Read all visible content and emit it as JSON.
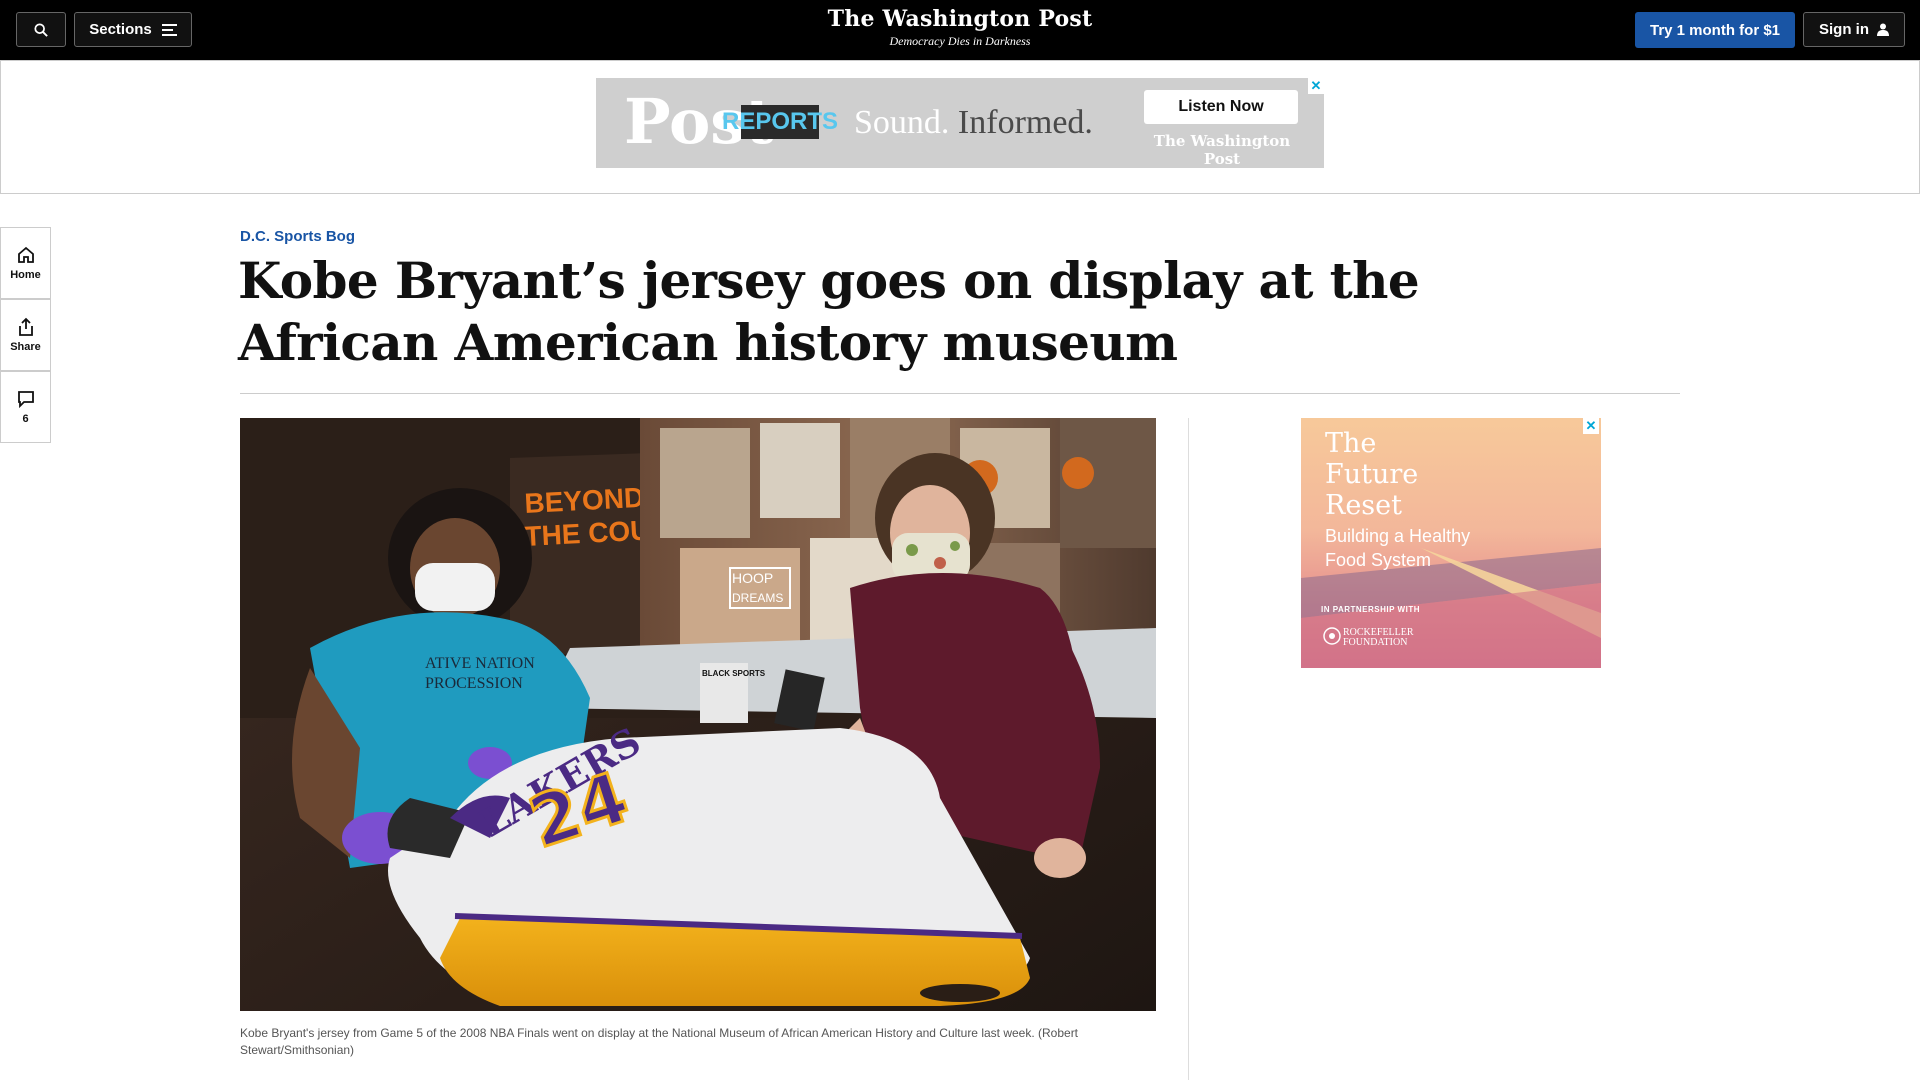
{
  "header": {
    "sections_label": "Sections",
    "logo": "The Washington Post",
    "tagline": "Democracy Dies in Darkness",
    "subscribe_label": "Try 1 month for $1",
    "signin_label": "Sign in",
    "bg_color": "#000000",
    "subscribe_color": "#1955a5"
  },
  "top_ad": {
    "logo_text": "Post",
    "logo_sub": "REPORTS",
    "slogan_a": "Sound.",
    "slogan_b": "Informed.",
    "cta": "Listen Now",
    "brand": "The Washington Post",
    "close": "✕"
  },
  "rail": {
    "home_label": "Home",
    "share_label": "Share",
    "comment_count": "6"
  },
  "article": {
    "kicker": "D.C. Sports Bog",
    "headline": "Kobe Bryant’s jersey goes on display at the African American history museum",
    "caption": "Kobe Bryant's jersey from Game 5 of the 2008 NBA Finals went on display at the National Museum of African American History and Culture last week. (Robert Stewart/Smithsonian)"
  },
  "photo": {
    "wall_text_1": "BEYOND",
    "wall_text_2": "THE COURT",
    "sign_1": "HOOP",
    "sign_2": "DREAMS",
    "magazine": "BLACK SPORTS",
    "shirt_1": "ATIVE NATION",
    "shirt_2": "PROCESSION",
    "jersey_team": "LAKERS",
    "jersey_number": "24"
  },
  "side_ad": {
    "title_1": "The",
    "title_2": "Future",
    "title_3": "Reset",
    "subtitle_1": "Building a Healthy",
    "subtitle_2": "Food System",
    "partner": "IN PARTNERSHIP WITH",
    "foundation": "ROCKEFELLER FOUNDATION",
    "close": "✕"
  }
}
